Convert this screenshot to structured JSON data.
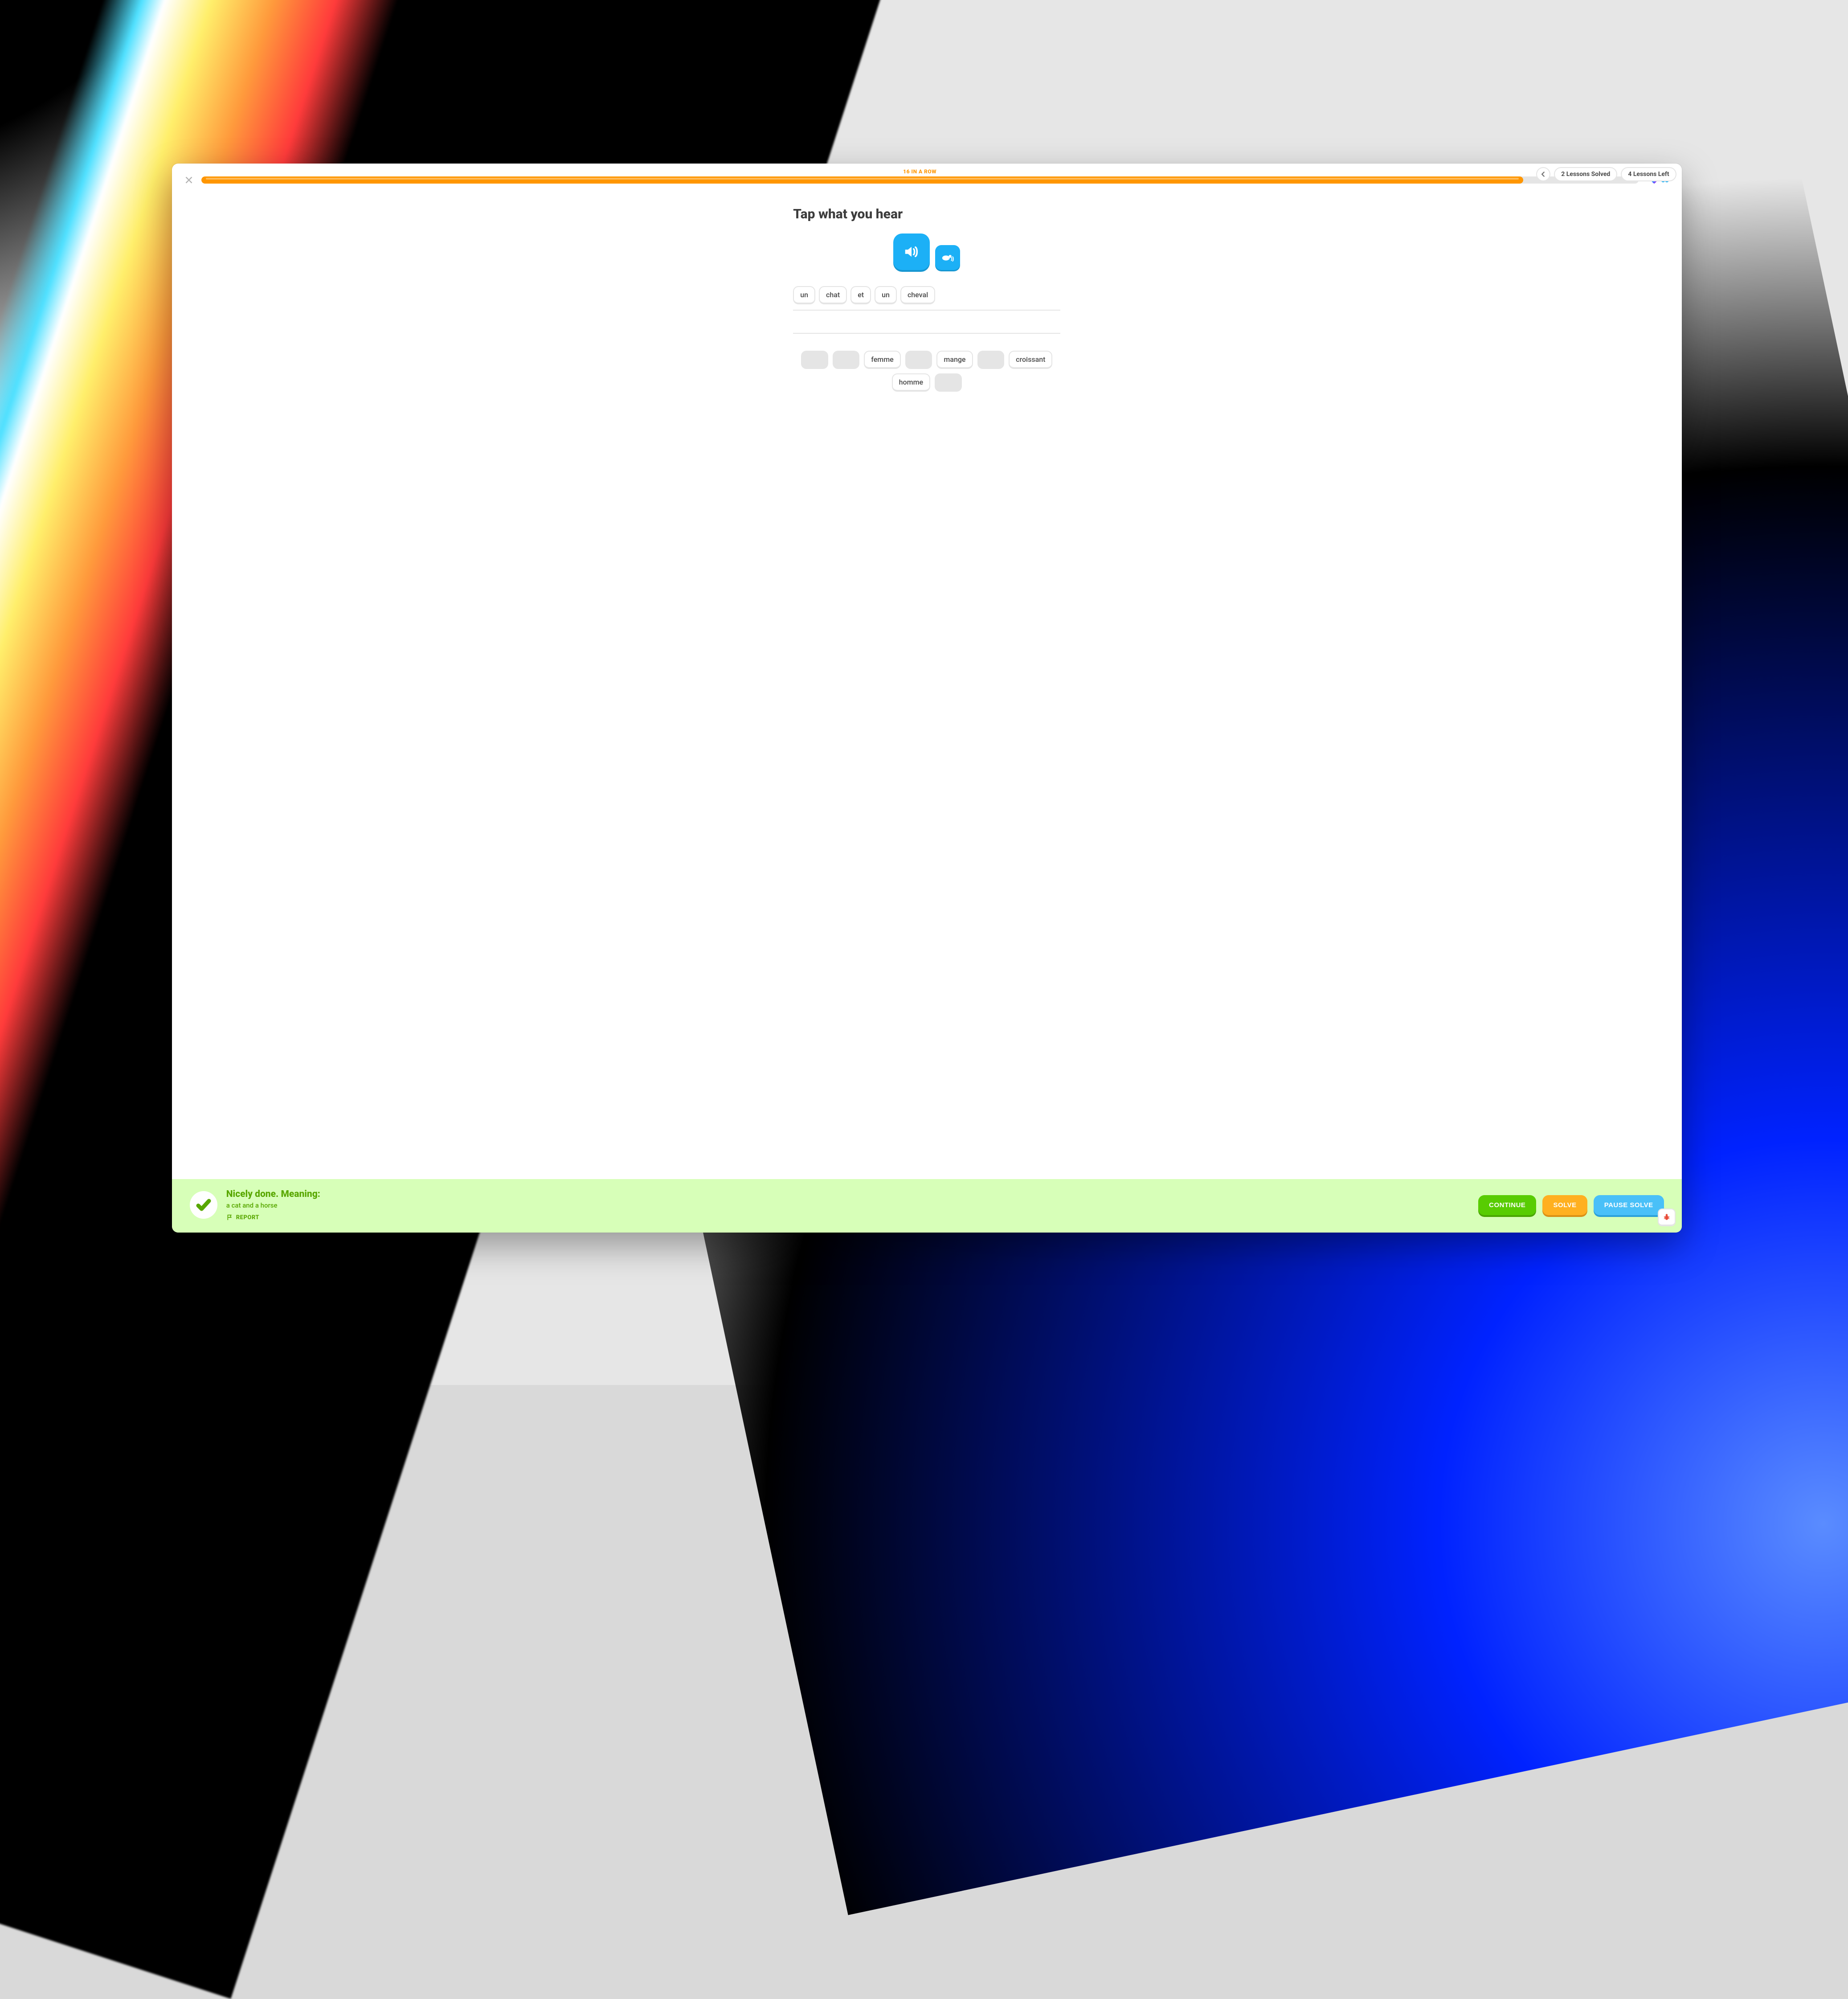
{
  "header": {
    "streak_label": "16 IN A ROW",
    "progress_percent": 92,
    "pills": {
      "solved": "2 Lessons Solved",
      "left": "4 Lessons Left"
    }
  },
  "exercise": {
    "prompt": "Tap what you hear",
    "answer_chips": [
      "un",
      "chat",
      "et",
      "un",
      "cheval"
    ],
    "bank": [
      {
        "label": "",
        "used": true
      },
      {
        "label": "",
        "used": true
      },
      {
        "label": "femme",
        "used": false
      },
      {
        "label": "",
        "used": true
      },
      {
        "label": "mange",
        "used": false
      },
      {
        "label": "",
        "used": true
      },
      {
        "label": "croissant",
        "used": false
      },
      {
        "label": "homme",
        "used": false
      },
      {
        "label": "",
        "used": true
      }
    ]
  },
  "feedback": {
    "title": "Nicely done. Meaning:",
    "subtitle": "a cat and a horse",
    "report_label": "REPORT"
  },
  "actions": {
    "continue": "CONTINUE",
    "solve": "SOLVE",
    "pause_solve": "PAUSE SOLVE"
  }
}
